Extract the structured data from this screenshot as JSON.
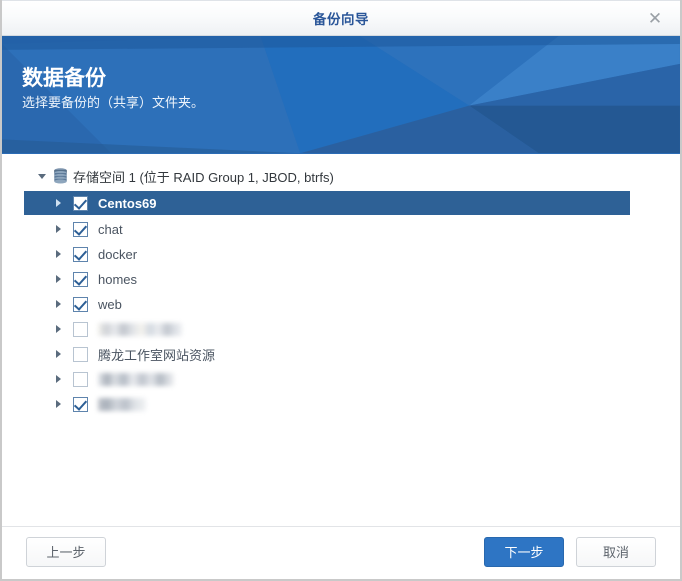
{
  "window": {
    "title": "备份向导",
    "close_icon": "close-icon",
    "close_glyph": "✕"
  },
  "banner": {
    "title": "数据备份",
    "subtitle": "选择要备份的（共享）文件夹。",
    "background_color": "#2b6cb5"
  },
  "tree": {
    "root": {
      "label": "存储空间 1 (位于 RAID Group 1, JBOD, btrfs)",
      "icon": "storage-volume-icon",
      "expanded": true,
      "caret_icon": "chevron-down-icon"
    },
    "items": [
      {
        "label": "Centos69",
        "checked": true,
        "selected": true,
        "blurred": false,
        "caret_icon": "chevron-right-icon"
      },
      {
        "label": "chat",
        "checked": true,
        "selected": false,
        "blurred": false,
        "caret_icon": "chevron-right-icon"
      },
      {
        "label": "docker",
        "checked": true,
        "selected": false,
        "blurred": false,
        "caret_icon": "chevron-right-icon"
      },
      {
        "label": "homes",
        "checked": true,
        "selected": false,
        "blurred": false,
        "caret_icon": "chevron-right-icon"
      },
      {
        "label": "web",
        "checked": true,
        "selected": false,
        "blurred": false,
        "caret_icon": "chevron-right-icon"
      },
      {
        "label": "",
        "checked": false,
        "selected": false,
        "blurred": true,
        "blur_style": "blur-a",
        "caret_icon": "chevron-right-icon"
      },
      {
        "label": "腾龙工作室网站资源",
        "checked": false,
        "selected": false,
        "blurred": false,
        "caret_icon": "chevron-right-icon"
      },
      {
        "label": "",
        "checked": false,
        "selected": false,
        "blurred": true,
        "blur_style": "blur-b",
        "caret_icon": "chevron-right-icon"
      },
      {
        "label": "",
        "checked": true,
        "selected": false,
        "blurred": true,
        "blur_style": "blur-c",
        "caret_icon": "chevron-right-icon"
      }
    ]
  },
  "footer": {
    "back_label": "上一步",
    "next_label": "下一步",
    "cancel_label": "取消",
    "primary_color": "#2e75c4"
  }
}
